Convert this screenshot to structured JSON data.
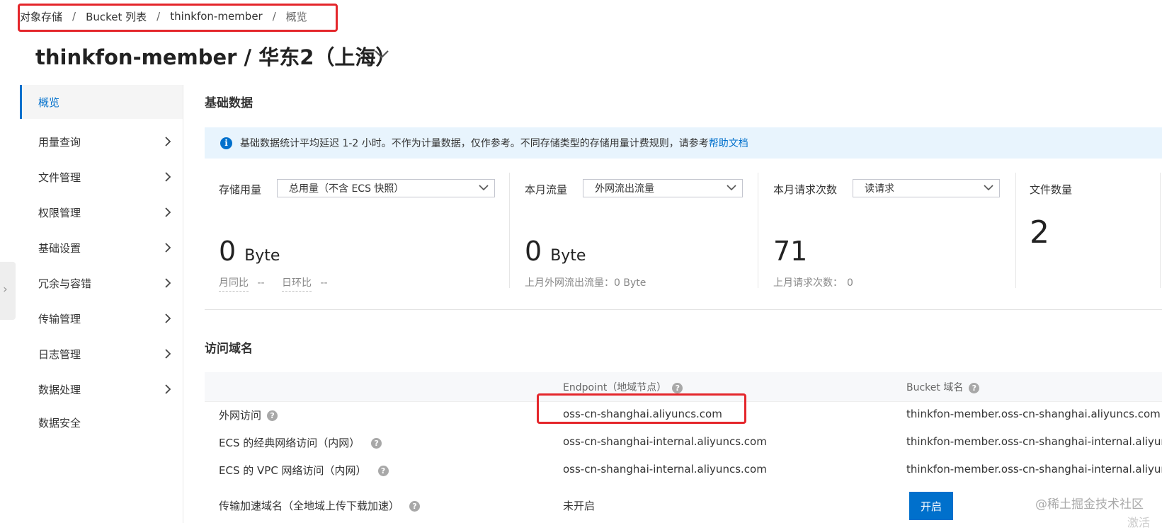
{
  "breadcrumb": {
    "items": [
      "对象存储",
      "Bucket 列表",
      "thinkfon-member",
      "概览"
    ],
    "separator": "/"
  },
  "page_title": "thinkfon-member / 华东2（上海）",
  "sidebar": {
    "side_handle_glyph": "›",
    "items": [
      {
        "label": "概览",
        "active": true,
        "has_arrow": false
      },
      {
        "label": "用量查询",
        "has_arrow": true
      },
      {
        "label": "文件管理",
        "has_arrow": true
      },
      {
        "label": "权限管理",
        "has_arrow": true
      },
      {
        "label": "基础设置",
        "has_arrow": true
      },
      {
        "label": "冗余与容错",
        "has_arrow": true
      },
      {
        "label": "传输管理",
        "has_arrow": true
      },
      {
        "label": "日志管理",
        "has_arrow": true
      },
      {
        "label": "数据处理",
        "has_arrow": true
      },
      {
        "label": "数据安全",
        "has_arrow": false
      }
    ]
  },
  "basic_data": {
    "title": "基础数据",
    "info_icon": "i",
    "info_text": "基础数据统计平均延迟 1-2 小时。不作为计量数据，仅作参考。不同存储类型的存储用量计费规则，请参考",
    "info_link": "帮助文档",
    "storage": {
      "label": "存储用量",
      "select_value": "总用量（不含 ECS 快照）",
      "value": "0",
      "unit": "Byte",
      "mom_label": "月同比",
      "mom_value": "--",
      "dod_label": "日环比",
      "dod_value": "--"
    },
    "traffic": {
      "label": "本月流量",
      "select_value": "外网流出流量",
      "value": "0",
      "unit": "Byte",
      "last_month": "上月外网流出流量：0 Byte"
    },
    "requests": {
      "label": "本月请求次数",
      "select_value": "读请求",
      "value": "71",
      "last_month_label": "上月请求次数：",
      "last_month_value": "0"
    },
    "files": {
      "label": "文件数量",
      "value": "2"
    }
  },
  "access_domains": {
    "title": "访问域名",
    "headers": {
      "endpoint": "Endpoint（地域节点）",
      "bucket_domain": "Bucket 域名"
    },
    "help_glyph": "?",
    "rows": [
      {
        "name": "外网访问",
        "endpoint": "oss-cn-shanghai.aliyuncs.com",
        "bucket_domain": "thinkfon-member.oss-cn-shanghai.aliyuncs.com"
      },
      {
        "name": "ECS 的经典网络访问（内网）",
        "endpoint": "oss-cn-shanghai-internal.aliyuncs.com",
        "bucket_domain": "thinkfon-member.oss-cn-shanghai-internal.aliyuncs.com"
      },
      {
        "name": "ECS 的 VPC 网络访问（内网）",
        "endpoint": "oss-cn-shanghai-internal.aliyuncs.com",
        "bucket_domain": "thinkfon-member.oss-cn-shanghai-internal.aliyuncs.com"
      }
    ],
    "accel_row": {
      "name": "传输加速域名（全地域上传下载加速）",
      "endpoint": "未开启",
      "button": "开启"
    }
  },
  "watermark": "@稀土掘金技术社区",
  "watermark_partial": "激活",
  "colors": {
    "accent": "#0070cc",
    "annotation": "#e4262b",
    "info_bg": "#e8f4fd"
  },
  "icons": [
    "chevron-down-icon",
    "chevron-right-icon",
    "info-icon",
    "help-icon"
  ]
}
